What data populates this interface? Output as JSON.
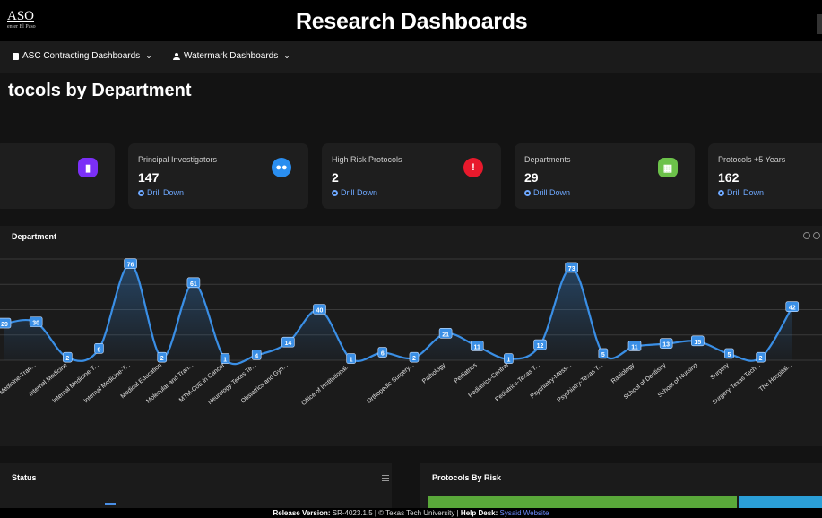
{
  "header": {
    "logo_text": "ASO",
    "logo_subtext": "enter El Paso",
    "title": "Research Dashboards"
  },
  "nav": {
    "items": [
      {
        "label": "ASC Contracting Dashboards",
        "icon": "document-icon"
      },
      {
        "label": "Watermark Dashboards",
        "icon": "person-icon"
      }
    ]
  },
  "page_title": "tocols by Department",
  "cards": [
    {
      "label": "",
      "value": "",
      "link": "",
      "icon": "book-icon",
      "icon_color": "#7b2ff7"
    },
    {
      "label": "Principal Investigators",
      "value": "147",
      "link": "Drill Down",
      "icon": "users-icon",
      "icon_color": "#2a8ef0"
    },
    {
      "label": "High Risk Protocols",
      "value": "2",
      "link": "Drill Down",
      "icon": "alert-icon",
      "icon_color": "#e8192c"
    },
    {
      "label": "Departments",
      "value": "29",
      "link": "Drill Down",
      "icon": "building-icon",
      "icon_color": "#6cc24a"
    },
    {
      "label": "Protocols +5 Years",
      "value": "162",
      "link": "Drill Down",
      "icon": "",
      "icon_color": ""
    }
  ],
  "chart_panel": {
    "title": "Department"
  },
  "chart_data": {
    "type": "line",
    "categories": [
      "",
      "Family Medicine-Tran...",
      "Internal Medicine",
      "Internal Medicine-T...",
      "Internal Medicine-T...",
      "Medical Education",
      "Molecular and Tran...",
      "MTM-CoE in Cancer",
      "Neurology-Texas Te...",
      "Obstetrics and Gyn...",
      "",
      "Office of Institutional...",
      "",
      "Orthopedic Surgery...",
      "Pathology",
      "Pediatrics",
      "Pediatrics-Central",
      "Pediatrics-Texas T...",
      "Psychiatry-Mess...",
      "Psychiatry-Texas T...",
      "Radiology",
      "School of Dentistry",
      "School of Nursing",
      "Surgery",
      "Surgery-Texas Tech...",
      "The Hospital..."
    ],
    "values": [
      29,
      30,
      2,
      9,
      76,
      2,
      61,
      1,
      4,
      14,
      40,
      1,
      6,
      2,
      21,
      11,
      1,
      12,
      73,
      5,
      11,
      13,
      15,
      5,
      2,
      42
    ],
    "series_color": "#3a8fe6"
  },
  "status_panel": {
    "title": "Status"
  },
  "risk_panel": {
    "title": "Protocols By Risk"
  },
  "footer": {
    "release_label": "Release Version:",
    "release_value": "SR-4023.1.5 | © Texas Tech University |",
    "help_label": "Help Desk:",
    "help_link": "Sysaid Website"
  }
}
